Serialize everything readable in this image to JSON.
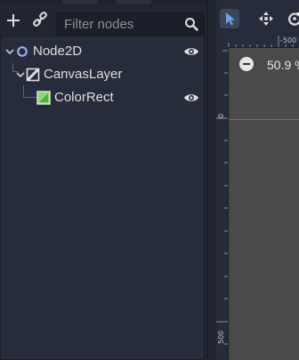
{
  "scene_dock": {
    "filter": {
      "placeholder": "Filter nodes",
      "value": ""
    },
    "tree": [
      {
        "label": "Node2D",
        "icon": "node2d-icon",
        "visible_toggle": true
      },
      {
        "label": "CanvasLayer",
        "icon": "canvas-layer-icon",
        "visible_toggle": false
      },
      {
        "label": "ColorRect",
        "icon": "color-rect-icon",
        "visible_toggle": true
      }
    ]
  },
  "viewport": {
    "zoom": "50.9 %",
    "ruler": {
      "top_label": "-500",
      "left_label_zero": "0",
      "left_label_500": "500"
    }
  },
  "colors": {
    "accent": "#6ba5ef",
    "axis_red": "#c24b57",
    "colorrect_green": "#8fd96a"
  }
}
